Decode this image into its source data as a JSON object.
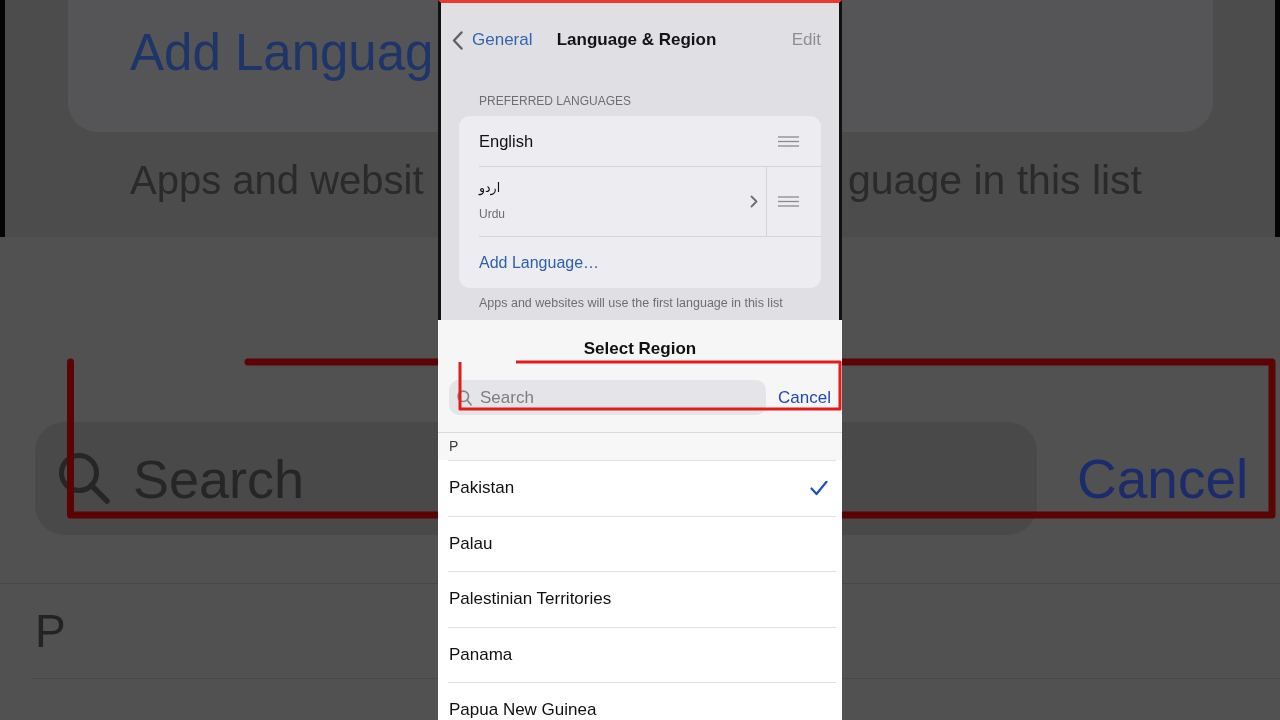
{
  "backdrop": {
    "add_language": "Add Languag",
    "footer_note_left": "Apps and websit",
    "footer_note_right": "guage in this list",
    "search": {
      "placeholder": "Search"
    },
    "cancel": "Cancel",
    "section_header": "P"
  },
  "settings": {
    "back": "General",
    "title": "Language & Region",
    "edit": "Edit",
    "section_header": "PREFERRED LANGUAGES",
    "languages": [
      {
        "kind": "plain",
        "name": "English"
      },
      {
        "kind": "detail",
        "name": "اردو",
        "subtitle": "Urdu"
      }
    ],
    "add_language": "Add Language…",
    "footer_note": "Apps and websites will use the first language in this list"
  },
  "sheet": {
    "title": "Select Region",
    "search": {
      "placeholder": "Search"
    },
    "cancel": "Cancel",
    "section_header": "P",
    "regions": [
      {
        "name": "Pakistan",
        "selected": true
      },
      {
        "name": "Palau",
        "selected": false
      },
      {
        "name": "Palestinian Territories",
        "selected": false
      },
      {
        "name": "Panama",
        "selected": false
      },
      {
        "name": "Papua New Guinea",
        "selected": false
      }
    ]
  }
}
